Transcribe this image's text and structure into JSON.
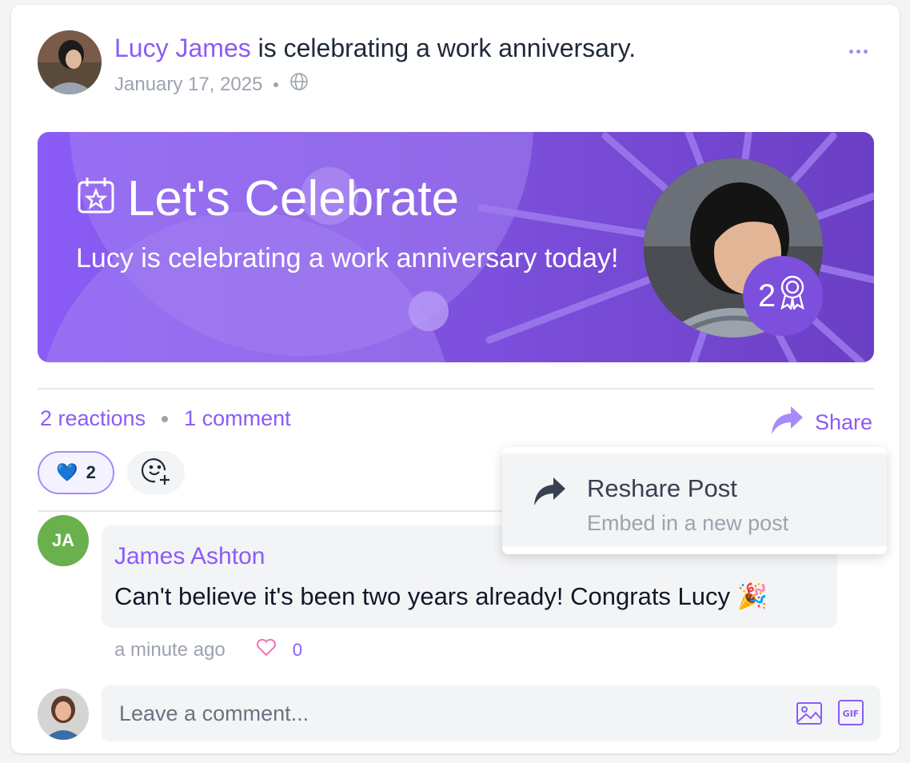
{
  "post": {
    "author": "Lucy James",
    "action": " is celebrating a work anniversary.",
    "date": "January 17, 2025",
    "visibility_icon": "globe-icon",
    "more_icon": "more-horizontal-icon"
  },
  "banner": {
    "title": "Let's Celebrate",
    "subtitle": "Lucy is celebrating a work anniversary today!",
    "years": "2",
    "title_icon": "calendar-star-icon",
    "badge_icon": "award-ribbon-icon"
  },
  "stats": {
    "reactions": "2 reactions",
    "comments": "1 comment",
    "share_label": "Share"
  },
  "reactions": {
    "emoji": "💙",
    "count": "2"
  },
  "share_menu": {
    "items": [
      {
        "title": "Reshare Post",
        "subtitle": "Embed in a new post",
        "icon": "share-arrow-icon"
      }
    ]
  },
  "comment": {
    "initials": "JA",
    "author": "James Ashton",
    "text": "Can't believe it's been two years already! Congrats Lucy 🎉",
    "time": "a minute ago",
    "likes": "0"
  },
  "composer": {
    "placeholder": "Leave a comment...",
    "image_icon": "image-icon",
    "gif_icon": "gif-icon"
  },
  "colors": {
    "accent": "#8b5cf6",
    "banner_start": "#8b5cf6",
    "banner_end": "#6b3fc4",
    "comment_avatar": "#6ab04c"
  }
}
